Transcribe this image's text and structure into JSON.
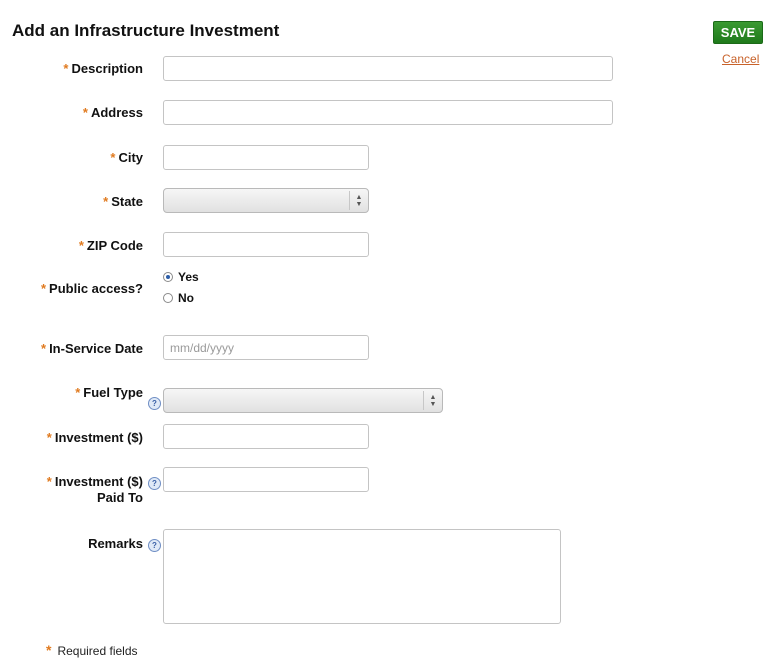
{
  "form": {
    "title": "Add an Infrastructure Investment",
    "save_label": "SAVE",
    "cancel_label": "Cancel",
    "required_star": "*",
    "required_note": "Required fields",
    "fields": {
      "description": {
        "label": "Description",
        "value": ""
      },
      "address": {
        "label": "Address",
        "value": ""
      },
      "city": {
        "label": "City",
        "value": ""
      },
      "state": {
        "label": "State",
        "selected": ""
      },
      "zip": {
        "label": "ZIP Code",
        "value": ""
      },
      "public_access": {
        "label": "Public access?",
        "options": [
          "Yes",
          "No"
        ],
        "selected": "Yes"
      },
      "in_service_date": {
        "label": "In-Service Date",
        "placeholder": "mm/dd/yyyy",
        "value": ""
      },
      "fuel_type": {
        "label": "Fuel Type",
        "selected": ""
      },
      "investment": {
        "label": "Investment ($)",
        "value": ""
      },
      "investment_paid_to": {
        "label_line1": "Investment ($)",
        "label_line2": "Paid To",
        "value": ""
      },
      "remarks": {
        "label": "Remarks",
        "value": ""
      }
    }
  },
  "icons": {
    "help": "help-info-icon",
    "select_arrows": "select-arrows-icon"
  },
  "colors": {
    "accent_star": "#e07a1f",
    "save_button": "#2a8a25",
    "cancel_link": "#c8622a"
  }
}
